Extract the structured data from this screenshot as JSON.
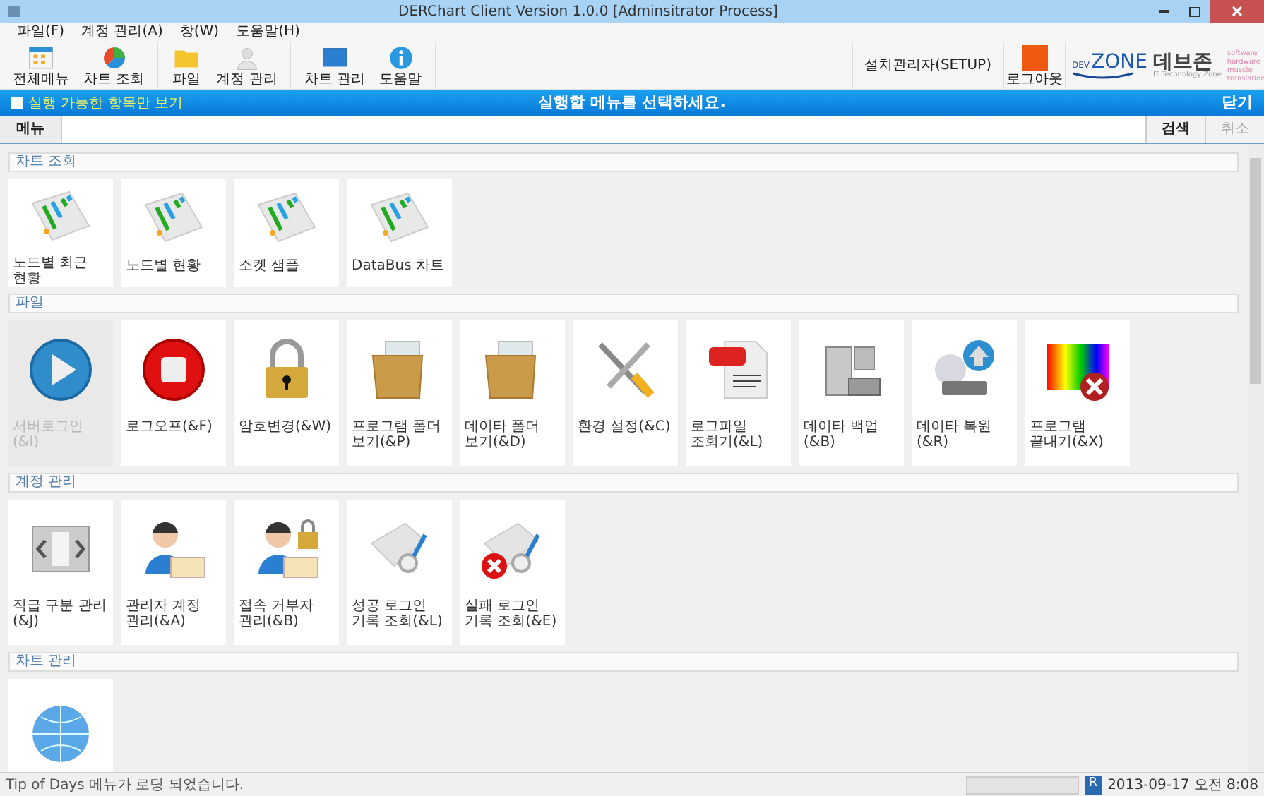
{
  "window": {
    "title": "DERChart Client Version 1.0.0 [Adminsitrator Process]"
  },
  "menu": [
    "파일(F)",
    "계정 관리(A)",
    "창(W)",
    "도움말(H)"
  ],
  "toolbar": {
    "groups": [
      [
        "전체메뉴",
        "차트 조회"
      ],
      [
        "파일",
        "계정 관리"
      ],
      [
        "차트 관리",
        "도움말"
      ]
    ],
    "setup": "설치관리자(SETUP)",
    "logout": "로그아웃"
  },
  "logo": {
    "prefix": "DEV",
    "name": "ZONE",
    "korean": "데브존",
    "tagline": "IT Technology Zone",
    "side": "software hardware muscle translation"
  },
  "banner": {
    "filter": {
      "label": "실행 가능한 항목만 보기",
      "checked": false
    },
    "message": "실행할 메뉴를 선택하세요.",
    "close": "닫기"
  },
  "search": {
    "tab": {
      "label": "메뉴",
      "selected": true
    },
    "buttons": [
      {
        "label": "검색",
        "disabled": false
      },
      {
        "label": "취소",
        "disabled": true
      }
    ]
  },
  "sections": [
    {
      "title": "차트 조회",
      "items": [
        {
          "label": "노드별 최근 현황",
          "disabled": false
        },
        {
          "label": "노드별 현황",
          "disabled": false
        },
        {
          "label": "소켓 샘플",
          "disabled": false
        },
        {
          "label": "DataBus 차트",
          "disabled": false
        }
      ]
    },
    {
      "title": "파일",
      "items": [
        {
          "label": "서버로그인(&I)",
          "disabled": true
        },
        {
          "label": "로그오프(&F)",
          "disabled": false
        },
        {
          "label": "암호변경(&W)",
          "disabled": false
        },
        {
          "label": "프로그램 폴더 보기(&P)",
          "disabled": false
        },
        {
          "label": "데이타 폴더 보기(&D)",
          "disabled": false
        },
        {
          "label": "환경 설정(&C)",
          "disabled": false
        },
        {
          "label": "로그파일 조회기(&L)",
          "disabled": false
        },
        {
          "label": "데이타 백업(&B)",
          "disabled": false
        },
        {
          "label": "데이타 복원(&R)",
          "disabled": false
        },
        {
          "label": "프로그램 끝내기(&X)",
          "disabled": false
        }
      ]
    },
    {
      "title": "계정 관리",
      "items": [
        {
          "label": "직급 구분 관리(&J)",
          "disabled": false
        },
        {
          "label": "관리자 계정 관리(&A)",
          "disabled": false
        },
        {
          "label": "접속 거부자 관리(&B)",
          "disabled": false
        },
        {
          "label": "성공 로그인 기록 조회(&L)",
          "disabled": false
        },
        {
          "label": "실패 로그인 기록 조회(&E)",
          "disabled": false
        }
      ]
    },
    {
      "title": "차트 관리",
      "items": [
        {
          "disabled": false
        }
      ]
    }
  ],
  "status_bar": {
    "message": "Tip of Days 메뉴가 로딩 되었습니다.",
    "badge": "R",
    "datetime": "2013-09-17 오전 8:08"
  }
}
